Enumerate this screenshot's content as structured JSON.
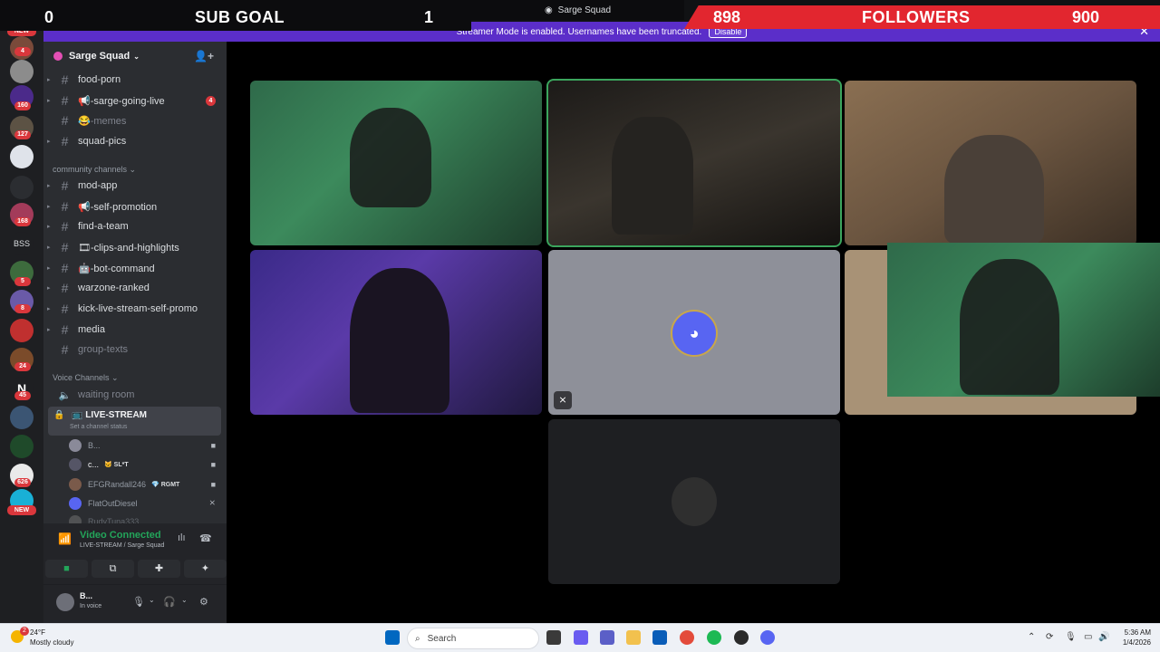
{
  "overlay": {
    "sub_goal": {
      "current": "0",
      "label": "SUB GOAL",
      "target": "1"
    },
    "followers": {
      "current": "898",
      "label": "FOLLOWERS",
      "target": "900"
    }
  },
  "window": {
    "title": "Sarge Squad"
  },
  "streamer_mode": {
    "message": "Streamer Mode is enabled. Usernames have been truncated.",
    "disable_label": "Disable"
  },
  "rail": {
    "badges": [
      "4",
      "160",
      "127",
      "168",
      "BSS",
      "5",
      "8",
      "24",
      "45",
      "626"
    ],
    "new_label": "NEW"
  },
  "server": {
    "name": "Sarge Squad"
  },
  "channels": [
    {
      "name": "food-porn",
      "prefix": ""
    },
    {
      "name": "-sarge-going-live",
      "prefix": "📢",
      "count": "4"
    },
    {
      "name": "-memes",
      "prefix": "😂"
    },
    {
      "name": "squad-pics",
      "prefix": ""
    }
  ],
  "community": {
    "label": "community channels",
    "channels": [
      {
        "name": "mod-app",
        "prefix": ""
      },
      {
        "name": "-self-promotion",
        "prefix": "📢"
      },
      {
        "name": "find-a-team",
        "prefix": ""
      },
      {
        "name": "-clips-and-highlights",
        "prefix": "🎞"
      },
      {
        "name": "-bot-command",
        "prefix": "🤖"
      },
      {
        "name": "warzone-ranked",
        "prefix": ""
      },
      {
        "name": "kick-live-stream-self-promo",
        "prefix": ""
      },
      {
        "name": "media",
        "prefix": ""
      },
      {
        "name": "group-texts",
        "prefix": ""
      }
    ]
  },
  "voice": {
    "label": "Voice Channels",
    "waiting": "waiting room",
    "live": "LIVE-STREAM",
    "status_hint": "Set a channel status",
    "users": [
      {
        "name": "B...",
        "tag": ""
      },
      {
        "name": "c...",
        "tag": "🐱 SL*T"
      },
      {
        "name": "EFGRandall246",
        "tag": "💎 RGMT"
      },
      {
        "name": "FlatOutDiesel",
        "tag": ""
      },
      {
        "name": "RudyTuna333",
        "tag": ""
      }
    ]
  },
  "voice_panel": {
    "status": "Video Connected",
    "location": "LIVE-STREAM / Sarge Squad"
  },
  "user_panel": {
    "name": "B...",
    "status": "In voice"
  },
  "taskbar": {
    "weather_temp": "24°F",
    "weather_desc": "Mostly cloudy",
    "weather_badge": "2",
    "search_placeholder": "Search",
    "time": "5:36 AM",
    "date": "1/4/2026"
  },
  "colors": {
    "accent": "#5b2ec9",
    "followers_bar": "#e2262f",
    "connected": "#23a55a",
    "badge": "#da373c"
  }
}
